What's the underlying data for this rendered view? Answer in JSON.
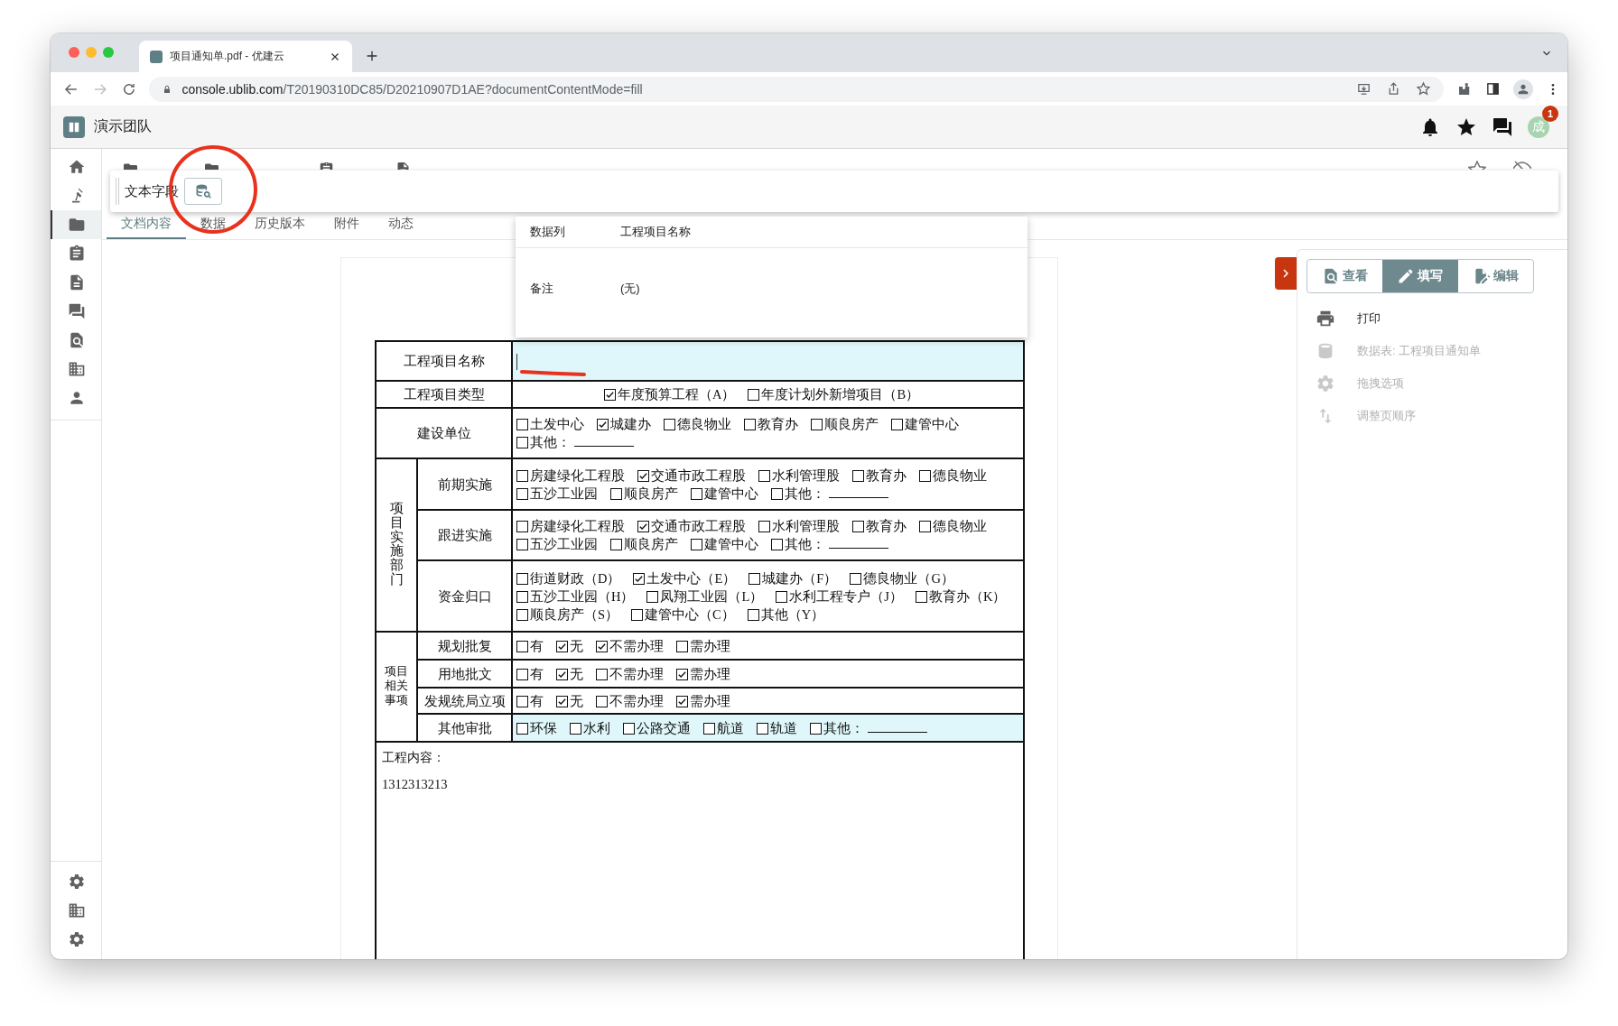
{
  "browser": {
    "tab_title": "项目通知单.pdf - 优建云",
    "url_host": "console.ublib.com",
    "url_path": "/T20190310DC85/D20210907D1AE?documentContentMode=fill"
  },
  "app": {
    "team": "演示团队",
    "notification_badge": "1",
    "avatar": "成"
  },
  "sidebar": {
    "items": [
      {
        "selected": false
      },
      {
        "selected": false
      },
      {
        "selected": true
      },
      {
        "selected": false
      },
      {
        "selected": false
      },
      {
        "selected": false
      },
      {
        "selected": false
      },
      {
        "selected": false
      },
      {
        "selected": false
      }
    ]
  },
  "field_toolbar": {
    "label": "文本字段"
  },
  "tabs": [
    {
      "label": "文档内容",
      "selected": true
    },
    {
      "label": "数据",
      "selected": false
    },
    {
      "label": "历史版本",
      "selected": false
    },
    {
      "label": "附件",
      "selected": false
    },
    {
      "label": "动态",
      "selected": false
    }
  ],
  "data_popup": {
    "rows": [
      {
        "label": "数据列",
        "value": "工程项目名称"
      },
      {
        "label": "备注",
        "value": "(无)"
      }
    ]
  },
  "form": {
    "rows": [
      {
        "kind": "text",
        "label": "工程项目名称",
        "highlighted": true,
        "focused": true
      },
      {
        "kind": "choices",
        "label": "工程项目类型",
        "highlighted": false,
        "centered": true,
        "options": [
          {
            "label": "年度预算工程（A）",
            "checked": true
          },
          {
            "label": "年度计划外新增项目（B）",
            "checked": false
          }
        ]
      },
      {
        "kind": "choices",
        "label": "建设单位",
        "highlighted": false,
        "centered": false,
        "options": [
          {
            "label": "土发中心",
            "checked": false
          },
          {
            "label": "城建办",
            "checked": true
          },
          {
            "label": "德良物业",
            "checked": false
          },
          {
            "label": "教育办",
            "checked": false
          },
          {
            "label": "顺良房产",
            "checked": false
          },
          {
            "label": "建管中心",
            "checked": false
          },
          {
            "label": "其他：",
            "checked": false,
            "blank": true
          }
        ]
      },
      {
        "kind": "group",
        "label": "项目实施部门",
        "vertical": true,
        "rows": [
          {
            "label": "前期实施",
            "highlighted": false,
            "options": [
              {
                "label": "房建绿化工程股",
                "checked": false
              },
              {
                "label": "交通市政工程股",
                "checked": true
              },
              {
                "label": "水利管理股",
                "checked": false
              },
              {
                "label": "教育办",
                "checked": false
              },
              {
                "label": "德良物业",
                "checked": false
              },
              {
                "label": "五沙工业园",
                "checked": false
              },
              {
                "label": "顺良房产",
                "checked": false
              },
              {
                "label": "建管中心",
                "checked": false
              },
              {
                "label": "其他：",
                "checked": false,
                "blank": true
              }
            ]
          },
          {
            "label": "跟进实施",
            "highlighted": false,
            "options": [
              {
                "label": "房建绿化工程股",
                "checked": false
              },
              {
                "label": "交通市政工程股",
                "checked": true
              },
              {
                "label": "水利管理股",
                "checked": false
              },
              {
                "label": "教育办",
                "checked": false
              },
              {
                "label": "德良物业",
                "checked": false
              },
              {
                "label": "五沙工业园",
                "checked": false
              },
              {
                "label": "顺良房产",
                "checked": false
              },
              {
                "label": "建管中心",
                "checked": false
              },
              {
                "label": "其他：",
                "checked": false,
                "blank": true
              }
            ]
          },
          {
            "label": "资金归口",
            "highlighted": false,
            "options": [
              {
                "label": "街道财政（D）",
                "checked": false
              },
              {
                "label": "土发中心（E）",
                "checked": true
              },
              {
                "label": "城建办（F）",
                "checked": false
              },
              {
                "label": "德良物业（G）",
                "checked": false
              },
              {
                "label": "五沙工业园（H）",
                "checked": false
              },
              {
                "label": "凤翔工业园（L）",
                "checked": false
              },
              {
                "label": "水利工程专户（J）",
                "checked": false
              },
              {
                "label": "教育办（K）",
                "checked": false
              },
              {
                "label": "顺良房产（S）",
                "checked": false
              },
              {
                "label": "建管中心（C）",
                "checked": false
              },
              {
                "label": "其他（Y）",
                "checked": false
              }
            ]
          }
        ]
      },
      {
        "kind": "group",
        "label": "项目相关事项",
        "vertical": false,
        "rows": [
          {
            "label": "规划批复",
            "highlighted": false,
            "options": [
              {
                "label": "有",
                "checked": false
              },
              {
                "label": "无",
                "checked": true
              },
              {
                "label": "不需办理",
                "checked": true
              },
              {
                "label": "需办理",
                "checked": false
              }
            ]
          },
          {
            "label": "用地批文",
            "highlighted": false,
            "options": [
              {
                "label": "有",
                "checked": false
              },
              {
                "label": "无",
                "checked": true
              },
              {
                "label": "不需办理",
                "checked": false
              },
              {
                "label": "需办理",
                "checked": true
              }
            ]
          },
          {
            "label": "发规统局立项",
            "highlighted": false,
            "options": [
              {
                "label": "有",
                "checked": false
              },
              {
                "label": "无",
                "checked": true
              },
              {
                "label": "不需办理",
                "checked": false
              },
              {
                "label": "需办理",
                "checked": true
              }
            ]
          },
          {
            "label": "其他审批",
            "highlighted": true,
            "options": [
              {
                "label": "环保",
                "checked": false
              },
              {
                "label": "水利",
                "checked": false
              },
              {
                "label": "公路交通",
                "checked": false
              },
              {
                "label": "航道",
                "checked": false
              },
              {
                "label": "轨道",
                "checked": false
              },
              {
                "label": "其他：",
                "checked": false,
                "blank": true
              }
            ]
          }
        ]
      },
      {
        "kind": "content",
        "label": "工程内容：",
        "value": "1312313213"
      }
    ]
  },
  "side_panel": {
    "modes": [
      {
        "label": "查看",
        "selected": false
      },
      {
        "label": "填写",
        "selected": true
      },
      {
        "label": "编辑",
        "selected": false
      }
    ],
    "actions": [
      {
        "label": "打印",
        "disabled": false
      },
      {
        "label": "数据表: 工程项目通知单",
        "disabled": true
      },
      {
        "label": "拖拽选项",
        "disabled": true
      },
      {
        "label": "调整页顺序",
        "disabled": true
      }
    ]
  }
}
